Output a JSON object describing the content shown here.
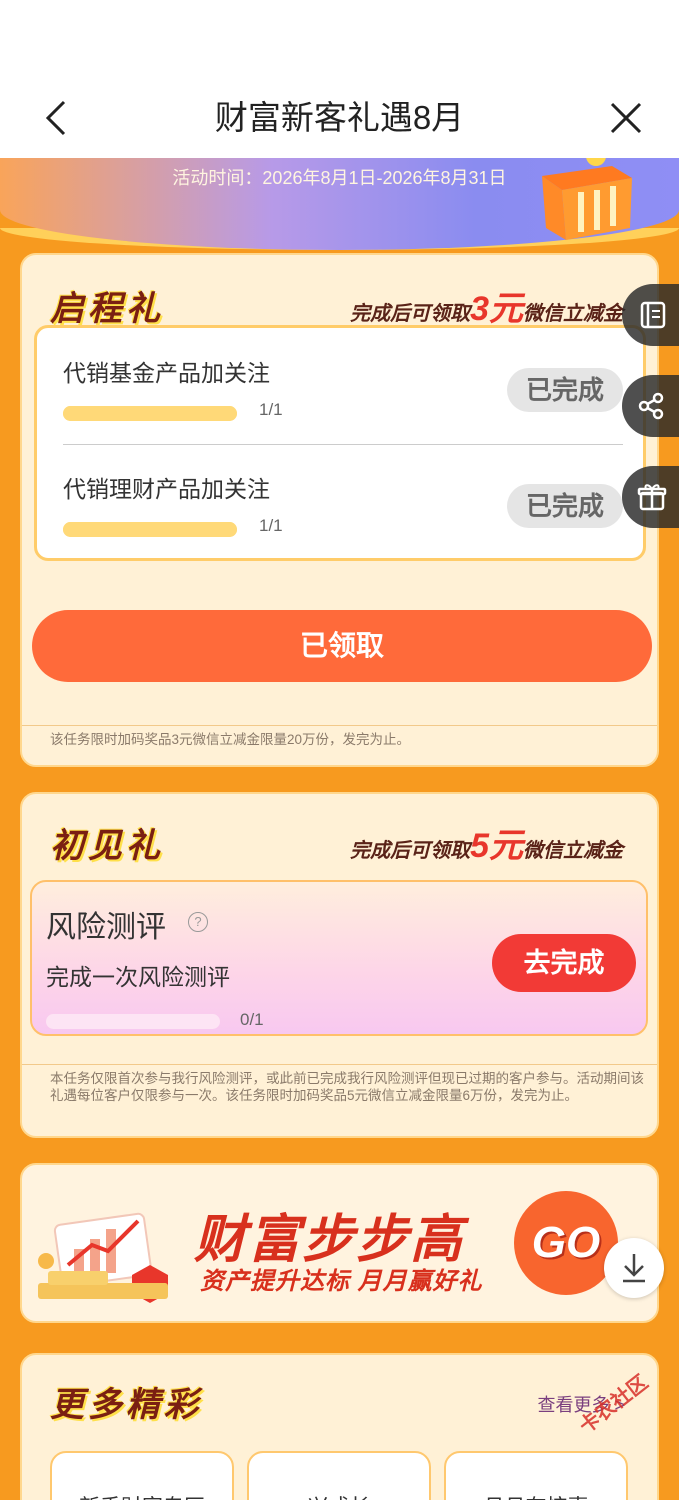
{
  "nav": {
    "title": "财富新客礼遇8月"
  },
  "banner": {
    "time": "活动时间：2026年8月1日-2026年8月31日"
  },
  "section1": {
    "title": "启程礼",
    "reward_prefix": "完成后可领取",
    "reward_amount": "3元",
    "reward_suffix": "微信立减金",
    "tasks": [
      {
        "name": "代销基金产品加关注",
        "count": "1/1",
        "progress": 1.0,
        "status": "已完成"
      },
      {
        "name": "代销理财产品加关注",
        "count": "1/1",
        "progress": 1.0,
        "status": "已完成"
      }
    ],
    "claim_label": "已领取",
    "note": "该任务限时加码奖品3元微信立减金限量20万份，发完为止。"
  },
  "section2": {
    "title": "初见礼",
    "reward_prefix": "完成后可领取",
    "reward_amount": "5元",
    "reward_suffix": "微信立减金",
    "task_title": "风险测评",
    "help_glyph": "?",
    "task_desc": "完成一次风险测评",
    "count": "0/1",
    "progress": 0,
    "action_label": "去完成",
    "note": "本任务仅限首次参与我行风险测评，或此前已完成我行风险测评但现已过期的客户参与。活动期间该礼遇每位客户仅限参与一次。该任务限时加码奖品5元微信立减金限量6万份，发完为止。"
  },
  "promo": {
    "title": "财富步步高",
    "subtitle": "资产提升达标 月月赢好礼",
    "go_label": "GO"
  },
  "more": {
    "title": "更多精彩",
    "see_more": "查看更多 >",
    "items": [
      "新手财富专区",
      "兴成长",
      "月月有惊喜"
    ]
  },
  "watermark": "卡农社区",
  "colors": {
    "page_bg": "#f79a1f",
    "accent_red": "#e8362b",
    "claim_button": "#ff6a3a",
    "go_button": "#f23a36"
  }
}
